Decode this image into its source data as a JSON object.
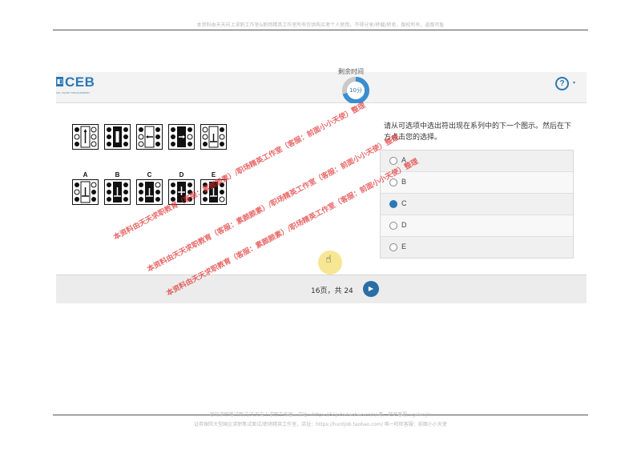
{
  "page_header_note": "本资料由天天向上求职工作室&职场精英工作室所有仅供购买者个人使用，不得分享/转载/转卖，版权所有，盗版可耻",
  "page_footer_note_1": "银行求职笔试面试/天天向上求职工作室，店址：https://51jobs.taobao.com/ 唯一旺旺客服：gelenjin",
  "page_footer_note_2": "证券保险大型国企求职笔试面试/职场精英工作室，店址：https://huntjob.taobao.com/ 唯一旺旺客服：前面小小天使",
  "app": {
    "logo_text": "CEB",
    "logo_subtext": "SHL TALENT MEASUREMENT",
    "timer_label": "剩余时间",
    "timer_value": "10分",
    "help_label": "?",
    "help_caret": "▾"
  },
  "question": {
    "sequence_count": 5,
    "answer_labels": [
      "A",
      "B",
      "C",
      "D",
      "E"
    ],
    "prompt": "请从可选项中选出符出现在系列中的下一个图示。然后在下方点击您的选择。",
    "options": [
      {
        "label": "A",
        "selected": false
      },
      {
        "label": "B",
        "selected": false
      },
      {
        "label": "C",
        "selected": true
      },
      {
        "label": "D",
        "selected": false
      },
      {
        "label": "E",
        "selected": false
      }
    ]
  },
  "footer": {
    "page_info": "16页，共 24",
    "next_icon": "▶"
  },
  "watermarks": [
    "本资料由天天求职教育（客服：素颜颜素）/职场精英工作室（客服：前面小小天使）整理",
    "本资料由天天求职教育（客服：素颜颜素）/职场精英工作室（客服：前面小小天使）整理",
    "本资料由天天求职教育（客服：素颜颜素）/职场精英工作室（客服：前面小小天使）整理"
  ],
  "colors": {
    "accent": "#2b79b5",
    "watermark": "#e12d2d"
  }
}
